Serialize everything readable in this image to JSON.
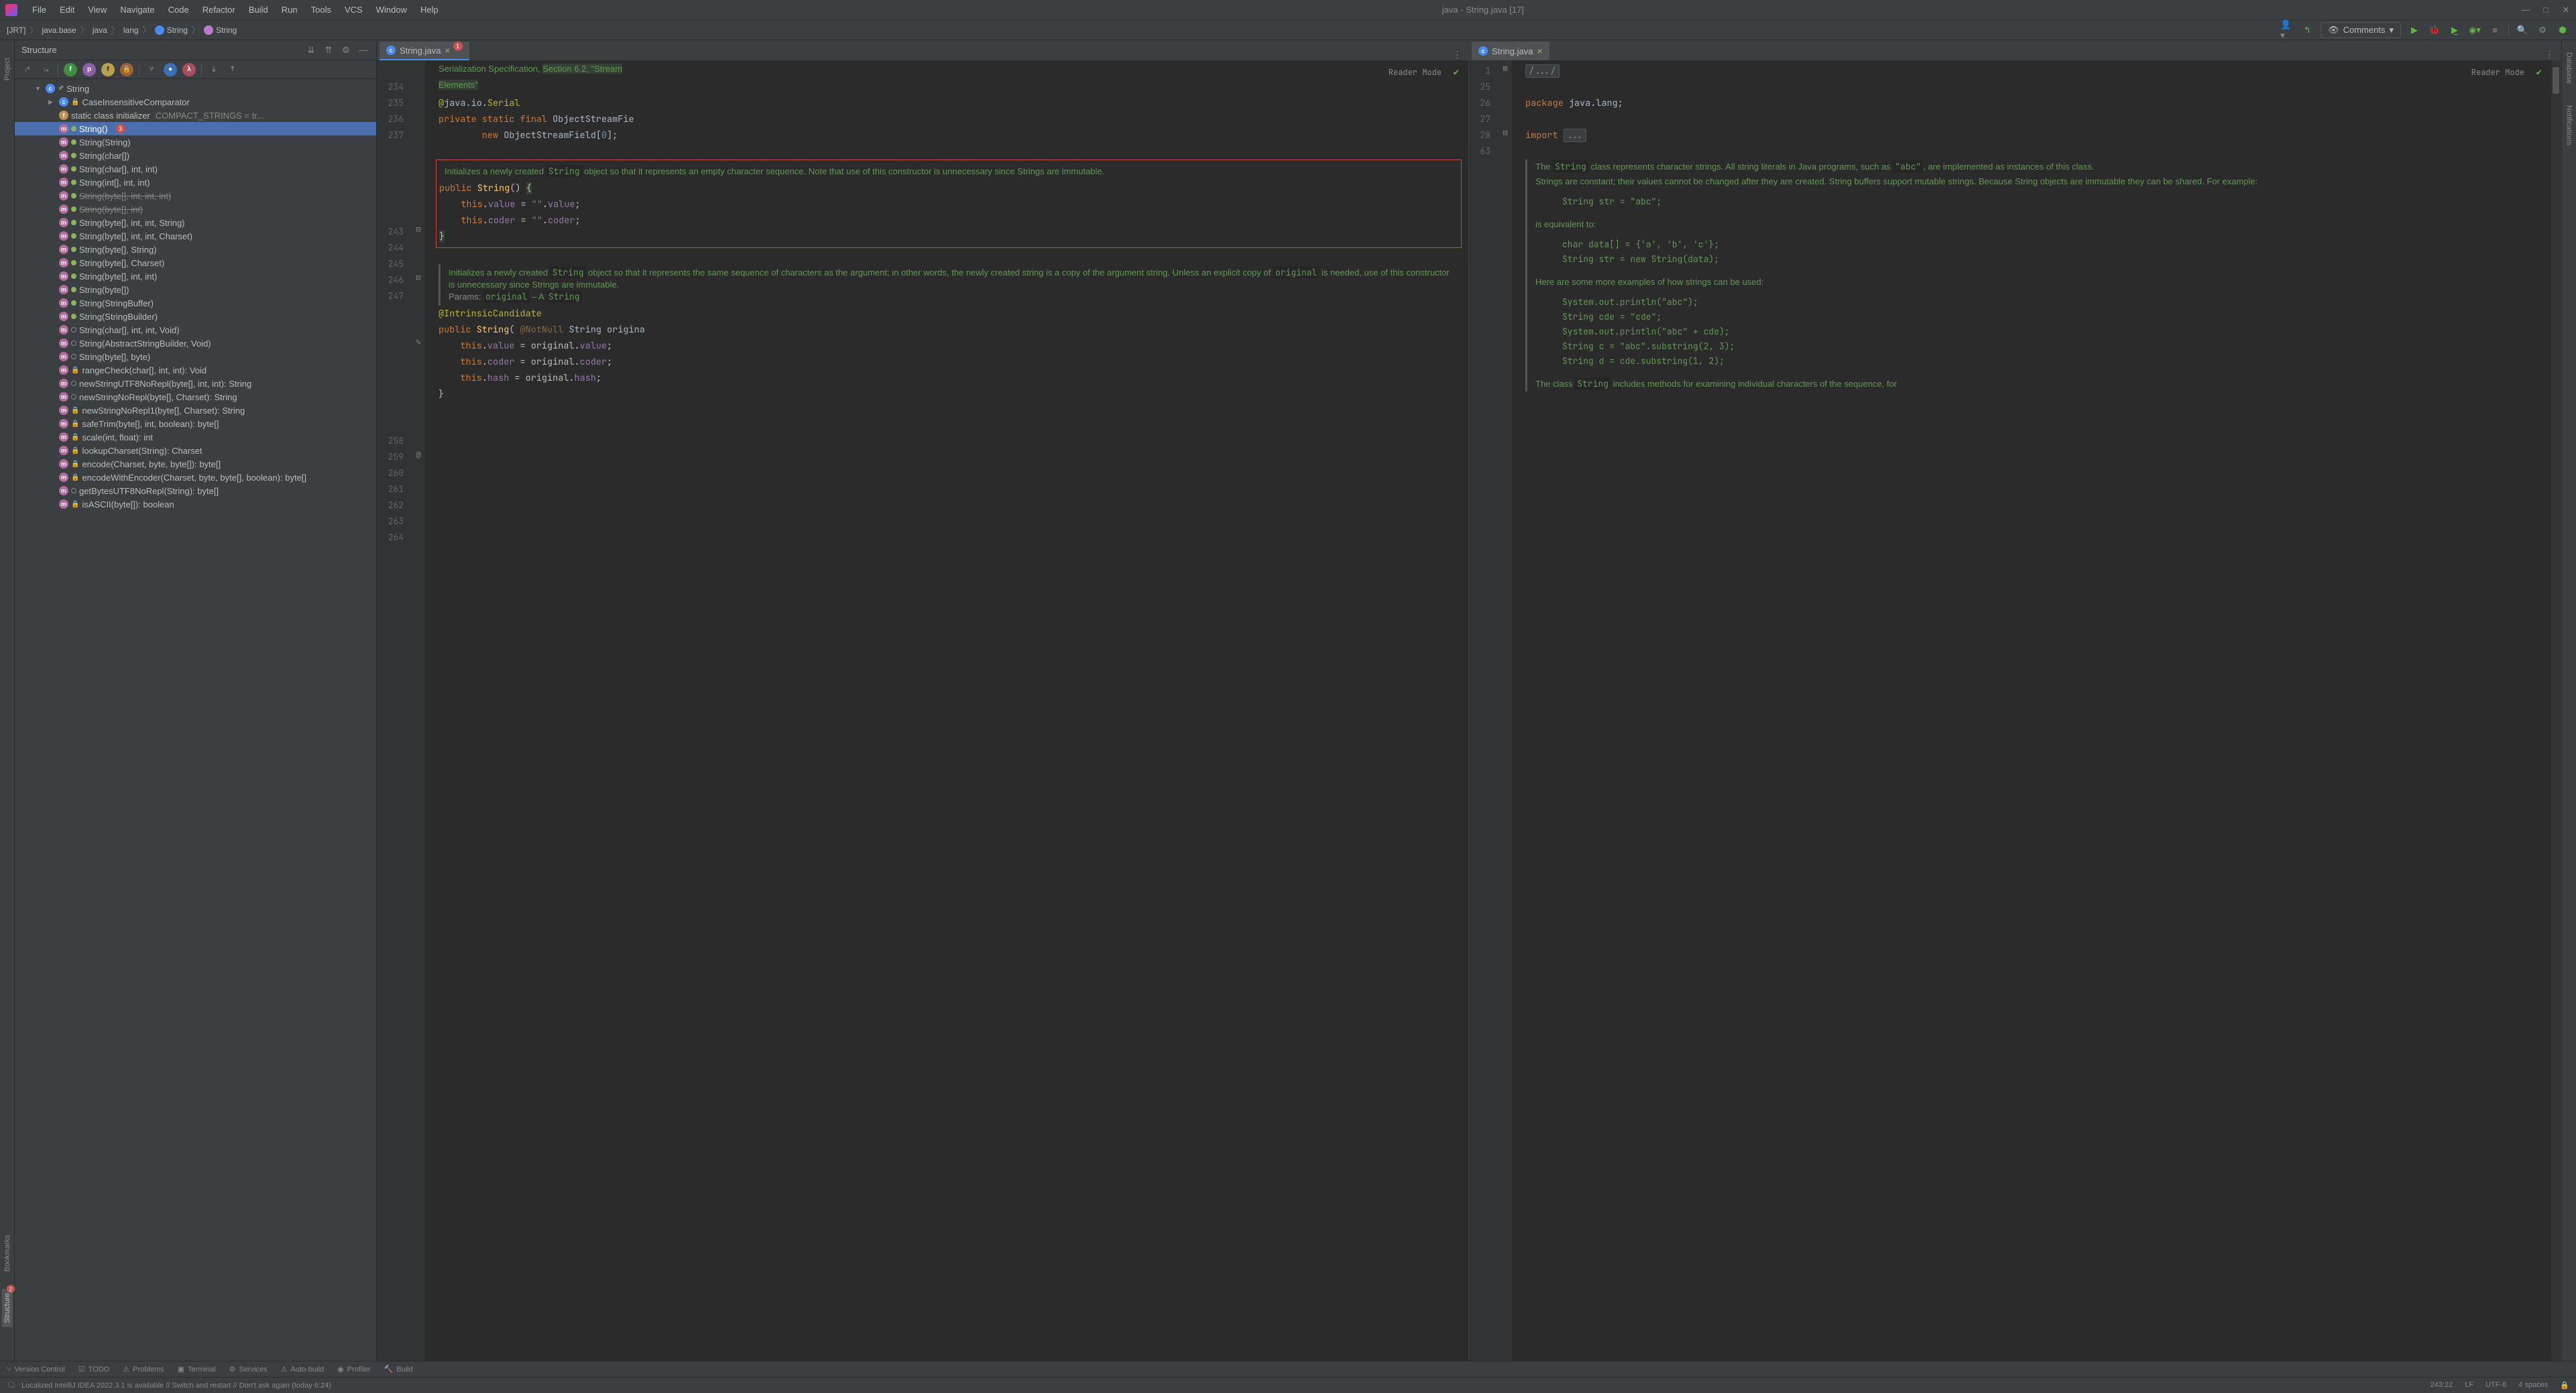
{
  "title": "java - String.java [17]",
  "menu": [
    "File",
    "Edit",
    "View",
    "Navigate",
    "Code",
    "Refactor",
    "Build",
    "Run",
    "Tools",
    "VCS",
    "Window",
    "Help"
  ],
  "breadcrumb": [
    {
      "label": "[JRT]"
    },
    {
      "label": "java.base"
    },
    {
      "label": "java"
    },
    {
      "label": "lang"
    },
    {
      "label": "String",
      "icon": "class"
    },
    {
      "label": "String",
      "icon": "method"
    }
  ],
  "comments_label": "Comments",
  "structure": {
    "title": "Structure",
    "root": {
      "label": "String",
      "badge": null
    },
    "items": [
      {
        "ico": "c",
        "mod": "lock",
        "text": "CaseInsensitiveComparator",
        "indent": 2,
        "arrow": "▶"
      },
      {
        "ico": "f",
        "mod": "",
        "text": "static class initializer",
        "extra": "COMPACT_STRINGS = tr...",
        "indent": 2
      },
      {
        "ico": "m",
        "mod": "grn",
        "text": "String()",
        "indent": 3,
        "selected": true,
        "badge": "3"
      },
      {
        "ico": "m",
        "mod": "grn",
        "text": "String(String)",
        "indent": 3
      },
      {
        "ico": "m",
        "mod": "grn",
        "text": "String(char[])",
        "indent": 3
      },
      {
        "ico": "m",
        "mod": "grn",
        "text": "String(char[], int, int)",
        "indent": 3
      },
      {
        "ico": "m",
        "mod": "grn",
        "text": "String(int[], int, int)",
        "indent": 3
      },
      {
        "ico": "m",
        "mod": "grn",
        "text": "String(byte[], int, int, int)",
        "indent": 3,
        "strike": true
      },
      {
        "ico": "m",
        "mod": "grn",
        "text": "String(byte[], int)",
        "indent": 3,
        "strike": true
      },
      {
        "ico": "m",
        "mod": "grn",
        "text": "String(byte[], int, int, String)",
        "indent": 3
      },
      {
        "ico": "m",
        "mod": "grn",
        "text": "String(byte[], int, int, Charset)",
        "indent": 3
      },
      {
        "ico": "m",
        "mod": "grn",
        "text": "String(byte[], String)",
        "indent": 3
      },
      {
        "ico": "m",
        "mod": "grn",
        "text": "String(byte[], Charset)",
        "indent": 3
      },
      {
        "ico": "m",
        "mod": "grn",
        "text": "String(byte[], int, int)",
        "indent": 3
      },
      {
        "ico": "m",
        "mod": "grn",
        "text": "String(byte[])",
        "indent": 3
      },
      {
        "ico": "m",
        "mod": "grn",
        "text": "String(StringBuffer)",
        "indent": 3
      },
      {
        "ico": "m",
        "mod": "grn",
        "text": "String(StringBuilder)",
        "indent": 3
      },
      {
        "ico": "m",
        "mod": "opn",
        "text": "String(char[], int, int, Void)",
        "indent": 3
      },
      {
        "ico": "m",
        "mod": "opn",
        "text": "String(AbstractStringBuilder, Void)",
        "indent": 3
      },
      {
        "ico": "m",
        "mod": "opn",
        "text": "String(byte[], byte)",
        "indent": 3
      },
      {
        "ico": "m",
        "mod": "lock",
        "text": "rangeCheck(char[], int, int): Void",
        "indent": 3
      },
      {
        "ico": "m",
        "mod": "opn",
        "text": "newStringUTF8NoRepl(byte[], int, int): String",
        "indent": 3
      },
      {
        "ico": "m",
        "mod": "opn",
        "text": "newStringNoRepl(byte[], Charset): String",
        "indent": 3
      },
      {
        "ico": "m",
        "mod": "lock",
        "text": "newStringNoRepl1(byte[], Charset): String",
        "indent": 3
      },
      {
        "ico": "m",
        "mod": "lock",
        "text": "safeTrim(byte[], int, boolean): byte[]",
        "indent": 3
      },
      {
        "ico": "m",
        "mod": "lock",
        "text": "scale(int, float): int",
        "indent": 3
      },
      {
        "ico": "m",
        "mod": "lock",
        "text": "lookupCharset(String): Charset",
        "indent": 3
      },
      {
        "ico": "m",
        "mod": "lock",
        "text": "encode(Charset, byte, byte[]): byte[]",
        "indent": 3
      },
      {
        "ico": "m",
        "mod": "lock",
        "text": "encodeWithEncoder(Charset, byte, byte[], boolean): byte[]",
        "indent": 3
      },
      {
        "ico": "m",
        "mod": "opn",
        "text": "getBytesUTF8NoRepl(String): byte[]",
        "indent": 3
      },
      {
        "ico": "m",
        "mod": "lock",
        "text": "isASCII(byte[]): boolean",
        "indent": 3
      }
    ]
  },
  "left_tabs": {
    "editor": {
      "tab": "String.java",
      "badge": "1"
    }
  },
  "right_tabs": {
    "editor": {
      "tab": "String.java"
    }
  },
  "reader_mode": "Reader Mode",
  "left_gutter": [
    "",
    "234",
    "235",
    "236",
    "237",
    "",
    "",
    "",
    "",
    "",
    "243",
    "244",
    "245",
    "246",
    "247",
    "",
    "",
    "",
    "",
    "",
    "",
    "",
    "",
    "258",
    "259",
    "260",
    "261",
    "262",
    "263",
    "264"
  ],
  "right_gutter": [
    "1",
    "25",
    "26",
    "27",
    "28",
    "63"
  ],
  "doc1": {
    "pre": "Serialization Specification, ",
    "link": "Section 6.2, \"Stream Elements\""
  },
  "code1": {
    "ann": "@java.io.Serial",
    "line2": "private static final ObjectStreamFie",
    "line3": "        new ObjectStreamField[0];"
  },
  "javadoc1": "Initializes a newly created String object so that it represents an empty character sequence. Note that use of this constructor is unnecessary since Strings are immutable.",
  "code2": {
    "sig": "public String() {",
    "l1": "    this.value = \"\".value;",
    "l2": "    this.coder = \"\".coder;",
    "end": "}"
  },
  "javadoc2": {
    "text": "Initializes a newly created String object so that it represents the same sequence of characters as the argument; in other words, the newly created string is a copy of the argument string. Unless an explicit copy of original is needed, use of this constructor is unnecessary since Strings are immutable.",
    "params": "Params: original – A String"
  },
  "code3": {
    "ann": "@IntrinsicCandidate",
    "sig": "public String( @NotNull String origina",
    "l1": "    this.value = original.value;",
    "l2": "    this.coder = original.coder;",
    "l3": "    this.hash = original.hash;",
    "end": "}"
  },
  "right_code": {
    "fold": "/.../",
    "pkg": "package java.lang;",
    "imp": "import ...",
    "doc1": "The String class represents character strings. All string literals in Java programs, such as \"abc\", are implemented as instances of this class.",
    "doc2": "Strings are constant; their values cannot be changed after they are created. String buffers support mutable strings. Because String objects are immutable they can be shared. For example:",
    "pre1": "    String str = \"abc\";",
    "doc3": "is equivalent to:",
    "pre2a": "    char data[] = {'a', 'b', 'c'};",
    "pre2b": "    String str = new String(data);",
    "doc4": "Here are some more examples of how strings can be used:",
    "pre3a": "    System.out.println(\"abc\");",
    "pre3b": "    String cde = \"cde\";",
    "pre3c": "    System.out.println(\"abc\" + cde);",
    "pre3d": "    String c = \"abc\".substring(2, 3);",
    "pre3e": "    String d = cde.substring(1, 2);",
    "doc5": "The class  String includes methods for examining individual characters of the sequence, for"
  },
  "bottom": [
    "Version Control",
    "TODO",
    "Problems",
    "Terminal",
    "Services",
    "Auto-build",
    "Profiler",
    "Build"
  ],
  "status": {
    "msg": "Localized IntelliJ IDEA 2022.3.1 is available // Switch and restart // Don't ask again (today 6:24)",
    "pos": "243:22",
    "le": "LF",
    "enc": "UTF-8",
    "indent": "4 spaces"
  },
  "rails": {
    "left": [
      "Project",
      "Bookmarks",
      "Structure"
    ],
    "right": [
      "Database",
      "Notifications"
    ]
  }
}
